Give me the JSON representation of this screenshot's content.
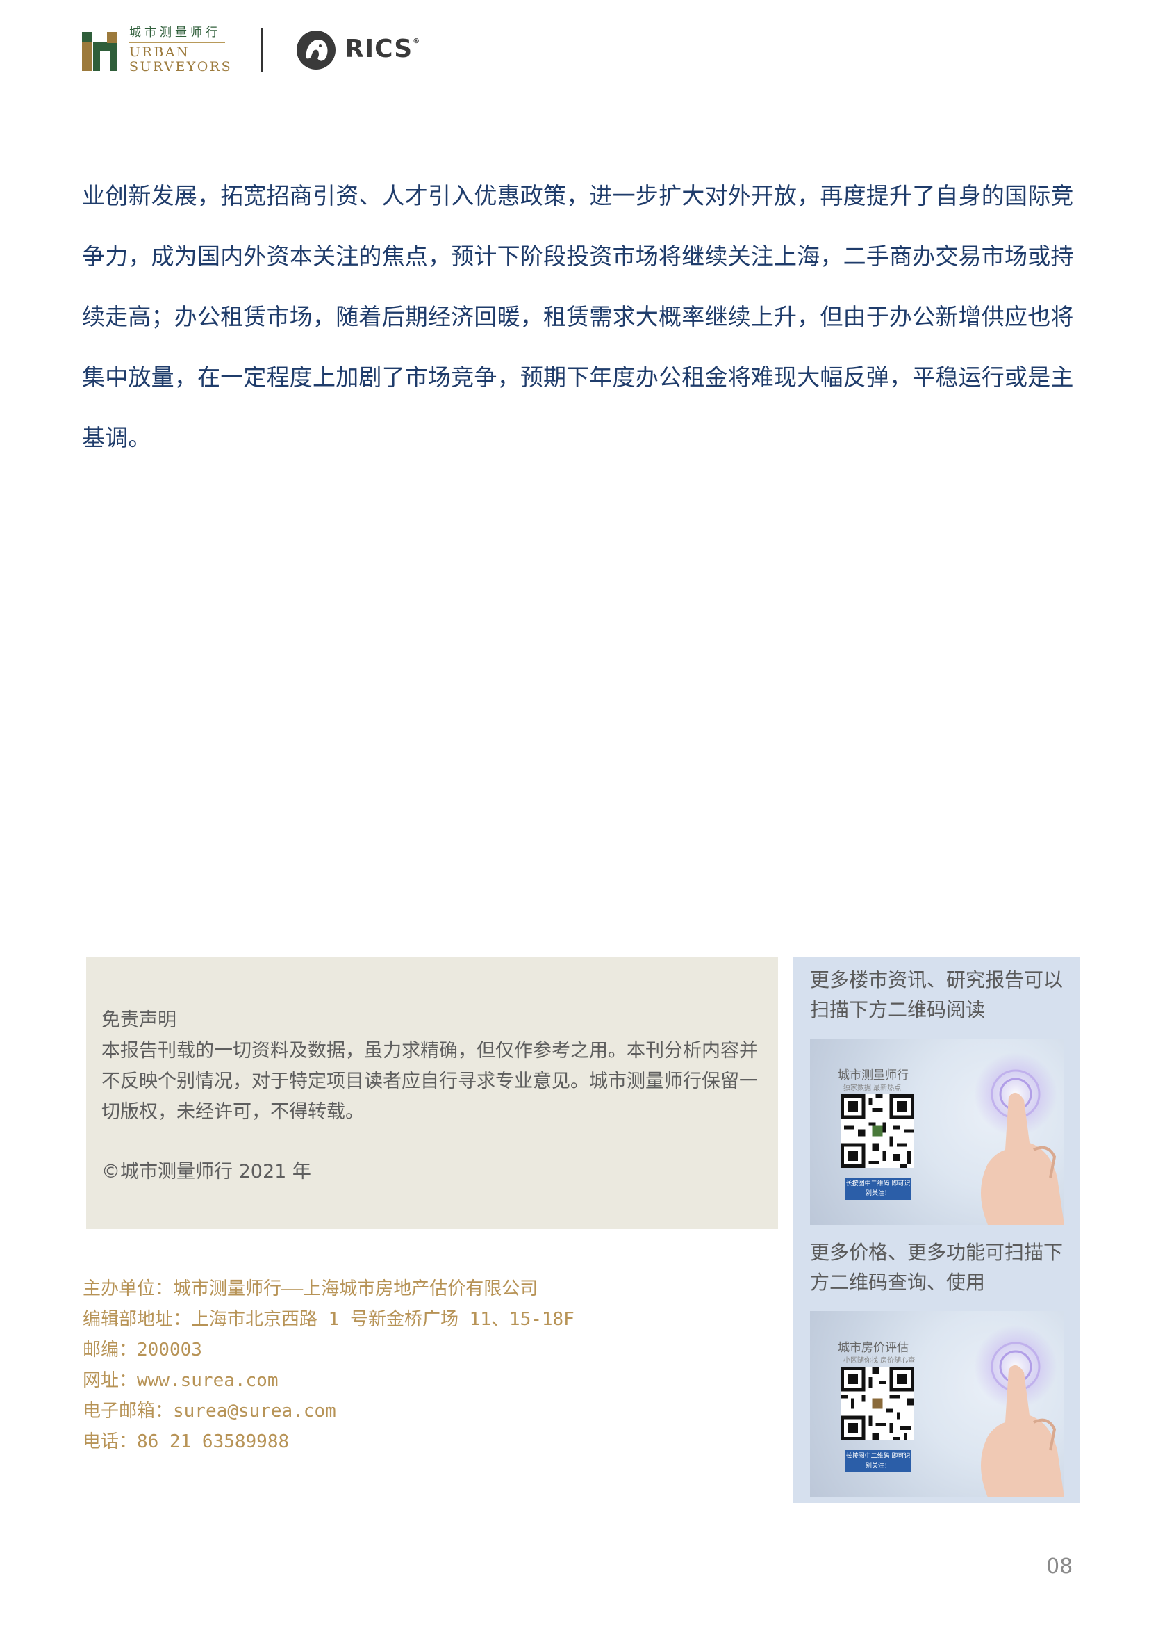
{
  "header": {
    "logo_cn": "城市测量师行",
    "logo_en_line1": "URBAN",
    "logo_en_line2": "SURVEYORS",
    "rics": "RICS",
    "rics_reg": "®"
  },
  "body": {
    "lines": [
      "业创新发展，拓宽招商引资、人才引入优惠政策，进一步扩大对外开放，再度提升了自身的国际竞",
      "争力，成为国内外资本关注的焦点，预计下阶段投资市场将继续关注上海，二手商办交易市场或持",
      "续走高；办公租赁市场，随着后期经济回暖，租赁需求大概率继续上升，但由于办公新增供应也将",
      "集中放量，在一定程度上加剧了市场竞争，预期下年度办公租金将难现大幅反弹，平稳运行或是主",
      "基调。"
    ]
  },
  "disclaimer": {
    "title": "免责声明",
    "body": "本报告刊载的一切资料及数据，虽力求精确，但仅作参考之用。本刊分析内容并不反映个别情况，对于特定项目读者应自行寻求专业意见。城市测量师行保留一切版权，未经许可，不得转载。",
    "copyright": "©城市测量师行 2021 年"
  },
  "contact": {
    "host": "主办单位：城市测量师行——上海城市房地产估价有限公司",
    "address": "编辑部地址：上海市北京西路 1 号新金桥广场 11、15-18F",
    "postcode": "邮编：200003",
    "website": "网址：www.surea.com",
    "email": "电子邮箱：surea@surea.com",
    "phone": "电话：86 21 63589988"
  },
  "qr": {
    "caption1": "更多楼市资讯、研究报告可以扫描下方二维码阅读",
    "card1_title": "城市测量师行",
    "card1_sub": "独家数据  最新热点",
    "card1_btn": "长按图中二维码 即可识别关注！",
    "caption2": "更多价格、更多功能可扫描下方二维码查询、使用",
    "card2_title": "城市房价评估",
    "card2_sub": "小区随你找  房价随心查",
    "card2_btn": "长按图中二维码 即可识别关注！"
  },
  "page_number": "08",
  "colors": {
    "body_text": "#1f3c6b",
    "contact_text": "#b79356",
    "disclaimer_bg": "#ebe9df",
    "qr_panel_bg": "#d6e0ee",
    "logo_green": "#2f5e3a",
    "logo_gold": "#9c7a3c"
  }
}
